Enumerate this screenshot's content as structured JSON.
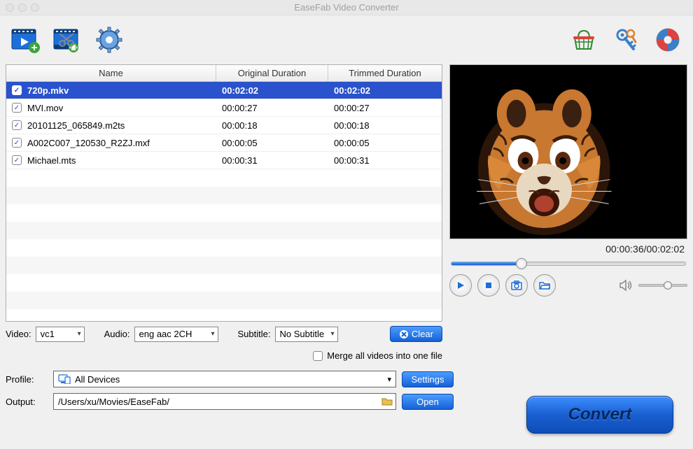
{
  "window": {
    "title": "EaseFab Video Converter"
  },
  "table": {
    "headers": {
      "name": "Name",
      "orig": "Original Duration",
      "trim": "Trimmed Duration"
    },
    "rows": [
      {
        "checked": true,
        "name": "720p.mkv",
        "orig": "00:02:02",
        "trim": "00:02:02",
        "selected": true
      },
      {
        "checked": true,
        "name": "MVI.mov",
        "orig": "00:00:27",
        "trim": "00:00:27",
        "selected": false
      },
      {
        "checked": true,
        "name": "20101125_065849.m2ts",
        "orig": "00:00:18",
        "trim": "00:00:18",
        "selected": false
      },
      {
        "checked": true,
        "name": "A002C007_120530_R2ZJ.mxf",
        "orig": "00:00:05",
        "trim": "00:00:05",
        "selected": false
      },
      {
        "checked": true,
        "name": "Michael.mts",
        "orig": "00:00:31",
        "trim": "00:00:31",
        "selected": false
      }
    ]
  },
  "controls": {
    "video_label": "Video:",
    "video_value": "vc1",
    "audio_label": "Audio:",
    "audio_value": "eng aac 2CH",
    "subtitle_label": "Subtitle:",
    "subtitle_value": "No Subtitle",
    "clear_label": "Clear",
    "merge_label": "Merge all videos into one file"
  },
  "profile": {
    "profile_label": "Profile:",
    "profile_value": "All Devices",
    "settings_label": "Settings",
    "output_label": "Output:",
    "output_value": "/Users/xu/Movies/EaseFab/",
    "open_label": "Open"
  },
  "preview": {
    "time": "00:00:36/00:02:02",
    "seek_pct": 30,
    "volume_pct": 60
  },
  "convert_label": "Convert"
}
